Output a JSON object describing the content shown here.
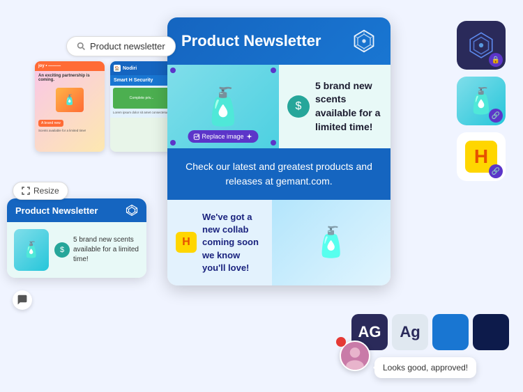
{
  "search": {
    "placeholder": "Product newsletter",
    "value": "Product newsletter"
  },
  "resize_btn": {
    "label": "Resize"
  },
  "mini_card": {
    "title": "Product Newsletter",
    "scent_text": "5 brand new scents available for a limited time!"
  },
  "main_card": {
    "title": "Product Newsletter",
    "section1_text": "5 brand new scents available for a limited time!",
    "section2_text": "Check our latest and greatest products and releases at gemant.com.",
    "section3_text": "We've got a new collab coming soon we know you'll love!",
    "replace_image_label": "Replace image"
  },
  "tooltip": {
    "text": "Looks good, approved!"
  },
  "icons": {
    "search": "🔍",
    "resize": "⤢",
    "chat": "💬",
    "scent": "💲",
    "collab_h": "H",
    "bottle": "🧴",
    "spray": "🧴",
    "person": "👩"
  },
  "font_labels": {
    "ag_dark": "AG",
    "ag_light": "Ag"
  }
}
